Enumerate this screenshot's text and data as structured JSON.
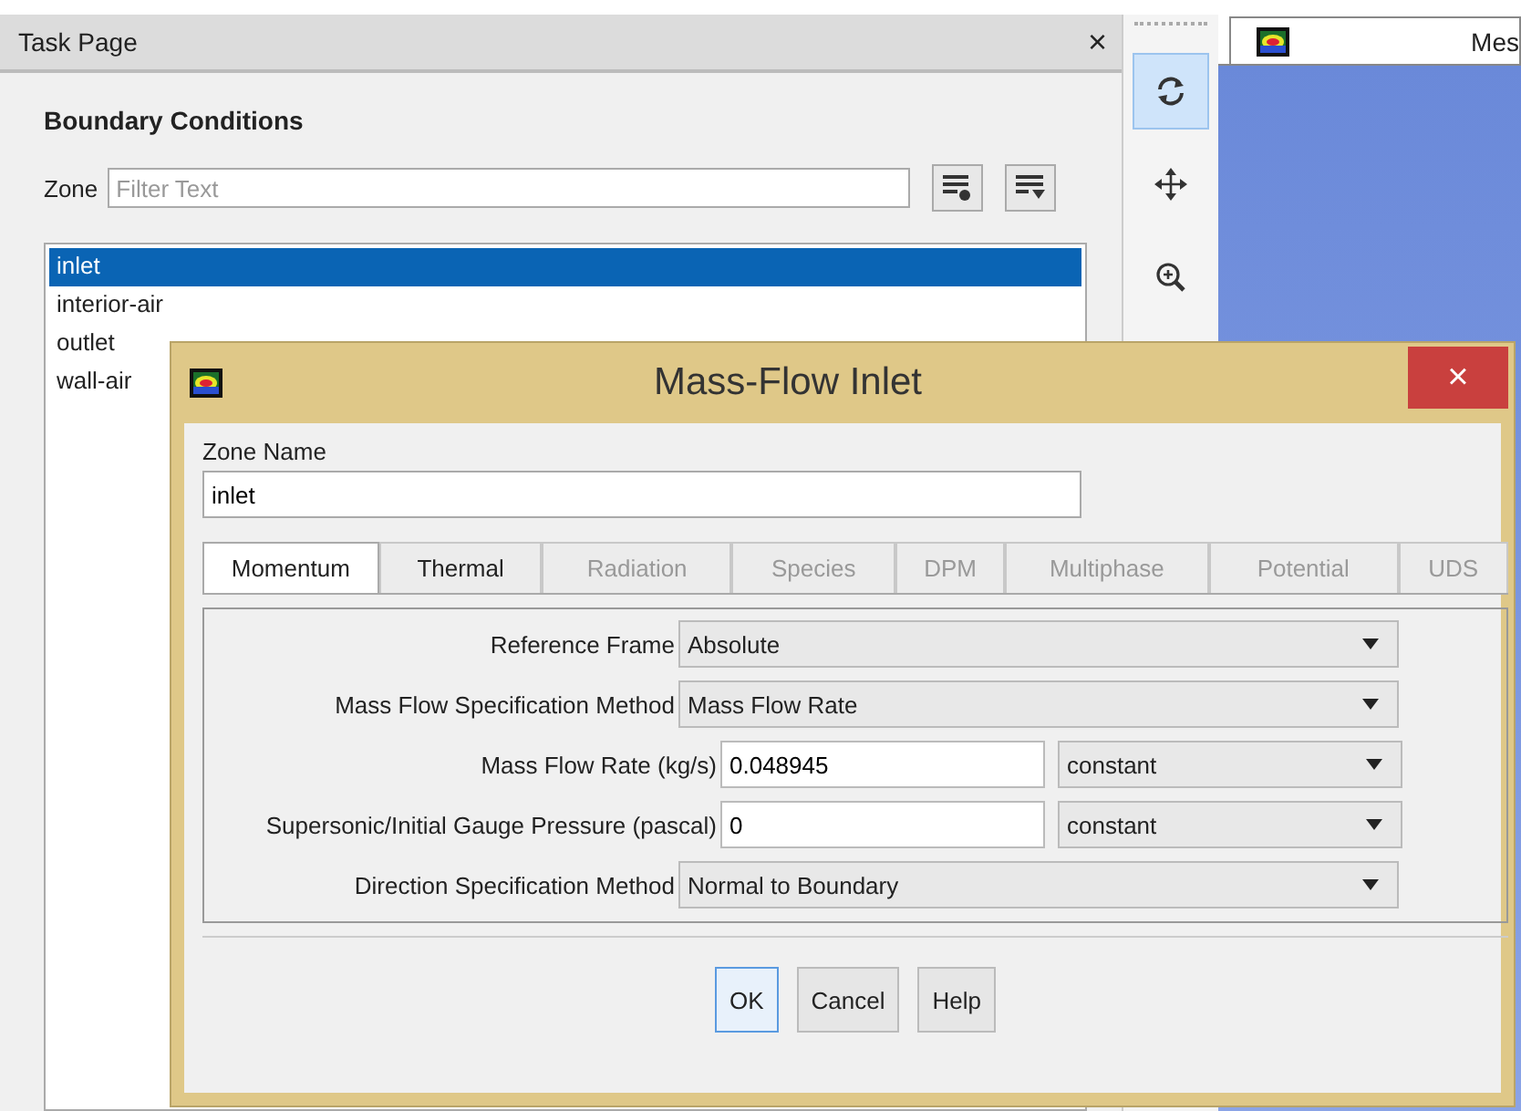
{
  "task_page": {
    "title": "Task Page",
    "close": "×",
    "heading": "Boundary Conditions",
    "zone_label": "Zone",
    "filter_placeholder": "Filter Text",
    "zones": [
      {
        "label": "inlet",
        "selected": true
      },
      {
        "label": "interior-air",
        "selected": false
      },
      {
        "label": "outlet",
        "selected": false
      },
      {
        "label": "wall-air",
        "selected": false
      }
    ]
  },
  "toolbar": [
    {
      "kind": "rotate",
      "selected": true
    },
    {
      "kind": "pan",
      "selected": false
    },
    {
      "kind": "zoom",
      "selected": false
    }
  ],
  "graphics": {
    "tab_label": "Mes"
  },
  "dialog": {
    "title": "Mass-Flow Inlet",
    "close": "×",
    "zone_name_label": "Zone Name",
    "zone_name": "inlet",
    "tabs": [
      {
        "label": "Momentum",
        "selected": true,
        "disabled": false
      },
      {
        "label": "Thermal",
        "selected": false,
        "disabled": false
      },
      {
        "label": "Radiation",
        "selected": false,
        "disabled": true
      },
      {
        "label": "Species",
        "selected": false,
        "disabled": true
      },
      {
        "label": "DPM",
        "selected": false,
        "disabled": true
      },
      {
        "label": "Multiphase",
        "selected": false,
        "disabled": true
      },
      {
        "label": "Potential",
        "selected": false,
        "disabled": true
      },
      {
        "label": "UDS",
        "selected": false,
        "disabled": true
      }
    ],
    "fields": [
      {
        "kind": "dropdown",
        "label": "Reference Frame",
        "value": "Absolute"
      },
      {
        "kind": "dropdown",
        "label": "Mass Flow Specification Method",
        "value": "Mass Flow Rate"
      },
      {
        "kind": "input",
        "label": "Mass Flow Rate (kg/s)",
        "value": "0.048945",
        "profile": "constant"
      },
      {
        "kind": "input",
        "label": "Supersonic/Initial Gauge Pressure (pascal)",
        "value": "0",
        "profile": "constant"
      },
      {
        "kind": "dropdown",
        "label": "Direction Specification Method",
        "value": "Normal to Boundary"
      }
    ],
    "buttons": [
      {
        "label": "OK",
        "focused": true
      },
      {
        "label": "Cancel",
        "focused": false
      },
      {
        "label": "Help",
        "focused": false
      }
    ]
  }
}
